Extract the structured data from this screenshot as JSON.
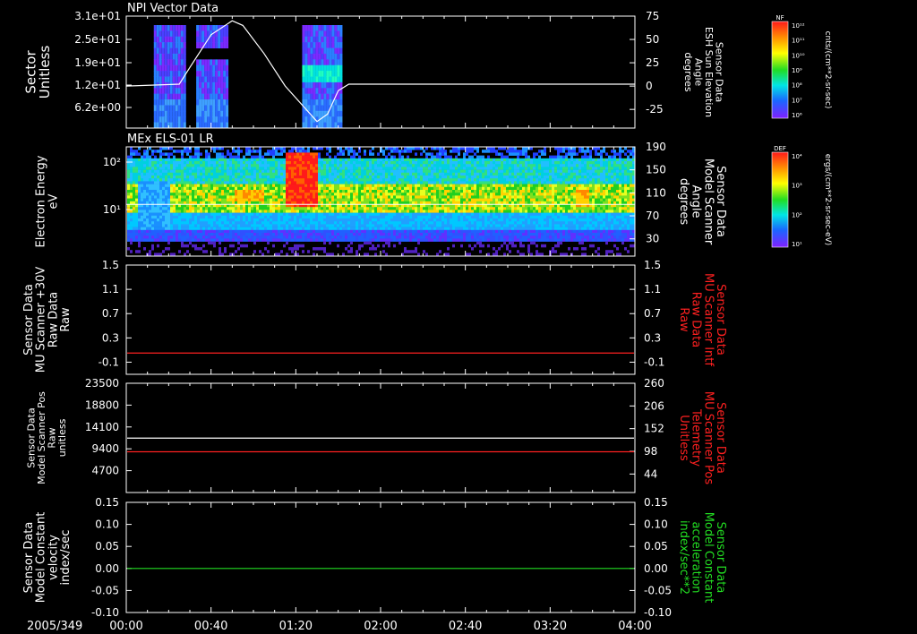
{
  "date_label": "2005/349",
  "time_ticks": [
    "00:00",
    "00:40",
    "01:20",
    "02:00",
    "02:40",
    "03:20",
    "04:00"
  ],
  "colors": {
    "white": "#ffffff",
    "red": "#ff2020",
    "green": "#22dd22",
    "background": "#000000"
  },
  "chart_data": [
    {
      "type": "heatmap",
      "title": "NPI Vector Data",
      "ylabel_left": [
        "Sector",
        "Unitless"
      ],
      "ylabel_right": [
        "Sensor Data",
        "ESH Sun Elevation",
        "Angle",
        "degrees"
      ],
      "left_ticks": [
        "3.1e+01",
        "2.5e+01",
        "1.9e+01",
        "1.2e+01",
        "6.2e+00"
      ],
      "right_ticks": [
        "75",
        "50",
        "25",
        "0",
        "-25"
      ],
      "right_ylim": [
        -45,
        75
      ],
      "x_range_minutes": [
        0,
        240
      ],
      "data_blocks_minutes": [
        [
          13,
          28
        ],
        [
          33,
          48
        ],
        [
          83,
          101
        ]
      ],
      "line_series": {
        "name": "ESH Sun Elevation Angle",
        "x_minutes": [
          0,
          25,
          30,
          40,
          50,
          55,
          65,
          75,
          90,
          95,
          100,
          105,
          115,
          240
        ],
        "y": [
          0,
          2,
          20,
          55,
          70,
          65,
          35,
          0,
          -38,
          -30,
          -5,
          2,
          2,
          2
        ]
      },
      "colorbar": {
        "label": "NF",
        "units": "cnts/(cm**2-sr-sec)",
        "tick_labels": [
          "10¹²",
          "10¹¹",
          "10¹⁰",
          "10⁹",
          "10⁸",
          "10⁷",
          "10⁶"
        ]
      }
    },
    {
      "type": "heatmap",
      "title": "MEx ELS-01 LR",
      "ylabel_left": [
        "Electron Energy",
        "eV"
      ],
      "ylabel_right": [
        "Sensor Data",
        "Model Scanner",
        "Angle",
        "degrees"
      ],
      "left_ticks": [
        "10²",
        "10¹"
      ],
      "right_ticks": [
        "190",
        "150",
        "110",
        "70",
        "30"
      ],
      "right_ylim": [
        0,
        190
      ],
      "x_range_minutes": [
        0,
        240
      ],
      "line_series": {
        "name": "Model Scanner Angle",
        "x_minutes": [
          0,
          240
        ],
        "y": [
          90,
          90
        ]
      },
      "colorbar": {
        "label": "DEF",
        "units": "ergs/(cm**2-sr-sec-eV)",
        "tick_labels": [
          "10⁴",
          "10³",
          "10²",
          "10¹"
        ]
      }
    },
    {
      "type": "line",
      "ylabel_left": [
        "Sensor Data",
        "MU Scanner +30V",
        "Raw Data",
        "Raw"
      ],
      "ylabel_right": [
        "Sensor Data",
        "MU Scanner Intf",
        "Raw Data",
        "Raw"
      ],
      "left_ticks": [
        "1.5",
        "1.1",
        "0.7",
        "0.3",
        "-0.1"
      ],
      "right_ticks": [
        "1.5",
        "1.1",
        "0.7",
        "0.3",
        "-0.1"
      ],
      "ylim": [
        -0.3,
        1.5
      ],
      "series": [
        {
          "name": "MU Scanner Intf Raw Data",
          "color": "red",
          "x_minutes": [
            0,
            240
          ],
          "y": [
            0.05,
            0.05
          ]
        }
      ]
    },
    {
      "type": "line",
      "ylabel_left": [
        "Sensor Data",
        "Model Scanner Pos",
        "Raw",
        "unitless"
      ],
      "ylabel_right": [
        "Sensor Data",
        "MU Scanner Pos",
        "Telemetry",
        "Unitless"
      ],
      "left_ticks": [
        "23500",
        "18800",
        "14100",
        "9400",
        "4700"
      ],
      "right_ticks": [
        "260",
        "206",
        "152",
        "98",
        "44"
      ],
      "ylim": [
        0,
        23500
      ],
      "right_ylim": [
        0,
        260
      ],
      "series": [
        {
          "name": "Model Scanner Pos Raw",
          "color": "white",
          "axis": "left",
          "x_minutes": [
            0,
            240
          ],
          "y": [
            11700,
            11700
          ]
        },
        {
          "name": "MU Scanner Pos Telemetry",
          "color": "red",
          "axis": "right",
          "x_minutes": [
            0,
            240
          ],
          "y": [
            97,
            97
          ]
        }
      ]
    },
    {
      "type": "line",
      "ylabel_left": [
        "Sensor Data",
        "Model Constant",
        "velocity",
        "index/sec"
      ],
      "ylabel_right": [
        "Sensor Data",
        "Model Constant",
        "acceleration",
        "index/sec**2"
      ],
      "left_ticks": [
        "0.15",
        "0.10",
        "0.05",
        "0.00",
        "-0.05",
        "-0.10"
      ],
      "right_ticks": [
        "0.15",
        "0.10",
        "0.05",
        "0.00",
        "-0.05",
        "-0.10"
      ],
      "ylim": [
        -0.1,
        0.15
      ],
      "series": [
        {
          "name": "Model Constant acceleration",
          "color": "green",
          "x_minutes": [
            0,
            240
          ],
          "y": [
            0.0,
            0.0
          ]
        }
      ]
    }
  ]
}
